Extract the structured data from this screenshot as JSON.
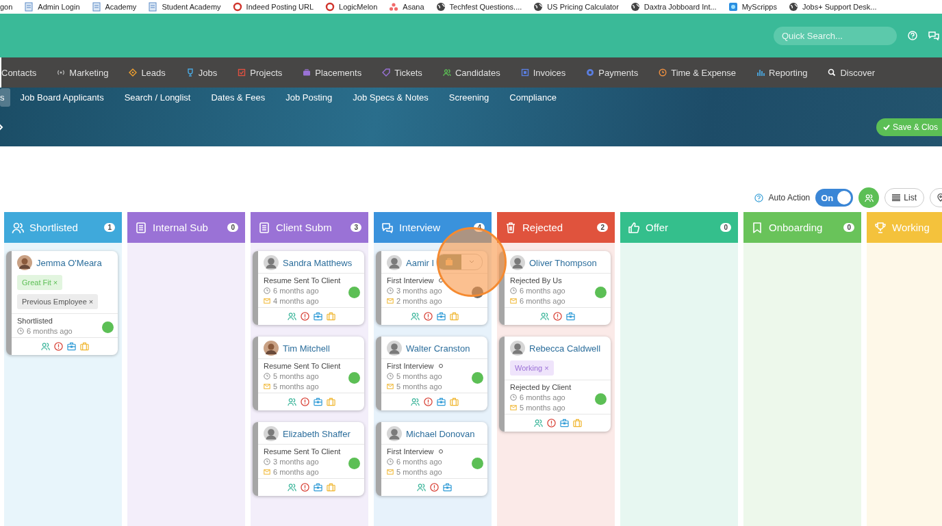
{
  "bookmarks": [
    {
      "label": "gon",
      "kind": "none"
    },
    {
      "label": "Admin Login",
      "kind": "page"
    },
    {
      "label": "Academy",
      "kind": "page"
    },
    {
      "label": "Student Academy",
      "kind": "page"
    },
    {
      "label": "Indeed Posting URL",
      "kind": "ring"
    },
    {
      "label": "LogicMelon",
      "kind": "ring"
    },
    {
      "label": "Asana",
      "kind": "dots"
    },
    {
      "label": "Techfest Questions....",
      "kind": "globe"
    },
    {
      "label": "US Pricing Calculator",
      "kind": "globe"
    },
    {
      "label": "Daxtra Jobboard Int...",
      "kind": "globe"
    },
    {
      "label": "MyScripps",
      "kind": "square"
    },
    {
      "label": "Jobs+ Support Desk...",
      "kind": "globe"
    }
  ],
  "search": {
    "placeholder": "Quick Search..."
  },
  "nav": [
    {
      "label": "Contacts",
      "kind": "none"
    },
    {
      "label": "Marketing",
      "kind": "antenna"
    },
    {
      "label": "Leads",
      "kind": "diamond"
    },
    {
      "label": "Jobs",
      "kind": "trophy"
    },
    {
      "label": "Projects",
      "kind": "checkbox"
    },
    {
      "label": "Placements",
      "kind": "briefcase"
    },
    {
      "label": "Tickets",
      "kind": "tag"
    },
    {
      "label": "Candidates",
      "kind": "people"
    },
    {
      "label": "Invoices",
      "kind": "square"
    },
    {
      "label": "Payments",
      "kind": "coin"
    },
    {
      "label": "Time & Expense",
      "kind": "clock"
    },
    {
      "label": "Reporting",
      "kind": "bars"
    },
    {
      "label": "Discover",
      "kind": "search"
    }
  ],
  "tabs": [
    {
      "label": "s",
      "selected": true
    },
    {
      "label": "Job Board Applicants",
      "selected": false
    },
    {
      "label": "Search / Longlist",
      "selected": false
    },
    {
      "label": "Dates & Fees",
      "selected": false
    },
    {
      "label": "Job Posting",
      "selected": false
    },
    {
      "label": "Job Specs & Notes",
      "selected": false
    },
    {
      "label": "Screening",
      "selected": false
    },
    {
      "label": "Compliance",
      "selected": false
    }
  ],
  "save_button": "Save & Clos",
  "toolbar": {
    "auto_action": "Auto Action",
    "toggle": {
      "label": "On",
      "on": true
    },
    "list_button": "List"
  },
  "columns": [
    {
      "title": "Shortlisted",
      "count": "1",
      "color": "#3fa9db",
      "kind": "people",
      "cards": [
        {
          "name": "Jemma O'Meara",
          "avatar": {
            "kind": "photo"
          },
          "tags": [
            {
              "label": "Great Fit",
              "remove": "×",
              "kind": "green"
            },
            {
              "label": "Previous Employee",
              "remove": "×",
              "kind": "grey"
            }
          ],
          "status": "Shortlisted",
          "created": "6 months ago",
          "color": "#5cbf55",
          "actions": [
            {
              "kind": "people"
            },
            {
              "kind": "alert"
            },
            {
              "kind": "briefcase"
            },
            {
              "kind": "case"
            }
          ]
        }
      ]
    },
    {
      "title": "Internal Sub",
      "count": "0",
      "color": "#9a72d6",
      "kind": "doc"
    },
    {
      "title": "Client Subm",
      "count": "3",
      "color": "#9a72d6",
      "kind": "doc",
      "cards": [
        {
          "name": "Sandra Matthews",
          "avatar": {
            "kind": "placeholder"
          },
          "status": "Resume Sent To Client",
          "created": "6 months ago",
          "emailed": "4 months ago",
          "color": "#5cbf55",
          "actions": [
            {
              "kind": "people"
            },
            {
              "kind": "alert"
            },
            {
              "kind": "briefcase"
            },
            {
              "kind": "case"
            }
          ]
        },
        {
          "name": "Tim Mitchell",
          "avatar": {
            "kind": "photo"
          },
          "status": "Resume Sent To Client",
          "created": "5 months ago",
          "emailed": "5 months ago",
          "color": "#5cbf55",
          "actions": [
            {
              "kind": "people"
            },
            {
              "kind": "alert"
            },
            {
              "kind": "briefcase"
            },
            {
              "kind": "case"
            }
          ]
        },
        {
          "name": "Elizabeth Shaffer",
          "avatar": {
            "kind": "placeholder"
          },
          "status": "Resume Sent To Client",
          "created": "3 months ago",
          "emailed": "6 months ago",
          "color": "#5cbf55",
          "actions": [
            {
              "kind": "people"
            },
            {
              "kind": "alert"
            },
            {
              "kind": "briefcase"
            },
            {
              "kind": "case"
            }
          ]
        }
      ]
    },
    {
      "title": "Interview",
      "count": "4",
      "color": "#3a92dc",
      "kind": "chat",
      "cards": [
        {
          "name": "Aamir I",
          "avatar": {
            "kind": "placeholder"
          },
          "status": "First Interview",
          "status_marker": true,
          "created": "3 months ago",
          "emailed": "2 months ago",
          "color": "#6b6b6b",
          "menu_open": true,
          "actions": [
            {
              "kind": "people"
            },
            {
              "kind": "alert"
            },
            {
              "kind": "briefcase"
            },
            {
              "kind": "case"
            }
          ]
        },
        {
          "name": "Walter Cranston",
          "avatar": {
            "kind": "placeholder"
          },
          "status": "First Interview",
          "status_marker": true,
          "created": "5 months ago",
          "emailed": "5 months ago",
          "color": "#5cbf55",
          "actions": [
            {
              "kind": "people"
            },
            {
              "kind": "alert"
            },
            {
              "kind": "briefcase"
            },
            {
              "kind": "case"
            }
          ]
        },
        {
          "name": "Michael Donovan",
          "avatar": {
            "kind": "placeholder"
          },
          "status": "First Interview",
          "status_marker": true,
          "created": "6 months ago",
          "emailed": "5 months ago",
          "color": "#5cbf55",
          "actions": [
            {
              "kind": "people"
            },
            {
              "kind": "alert"
            },
            {
              "kind": "briefcase"
            }
          ]
        }
      ]
    },
    {
      "title": "Rejected",
      "count": "2",
      "color": "#e0533d",
      "kind": "trash",
      "cards": [
        {
          "name": "Oliver Thompson",
          "avatar": {
            "kind": "placeholder"
          },
          "status": "Rejected By Us",
          "created": "6 months ago",
          "emailed": "6 months ago",
          "color": "#5cbf55",
          "actions": [
            {
              "kind": "people"
            },
            {
              "kind": "alert"
            },
            {
              "kind": "briefcase"
            }
          ]
        },
        {
          "name": "Rebecca Caldwell",
          "avatar": {
            "kind": "placeholder"
          },
          "tags": [
            {
              "label": "Working",
              "remove": "×",
              "kind": "purple"
            }
          ],
          "status": "Rejected by Client",
          "created": "6 months ago",
          "emailed": "5 months ago",
          "color": "#5cbf55",
          "actions": [
            {
              "kind": "people"
            },
            {
              "kind": "alert"
            },
            {
              "kind": "briefcase"
            },
            {
              "kind": "case"
            }
          ]
        }
      ]
    },
    {
      "title": "Offer",
      "count": "0",
      "color": "#34bf8c",
      "kind": "thumb"
    },
    {
      "title": "Onboarding",
      "count": "0",
      "color": "#69c35a",
      "kind": "bookmark"
    },
    {
      "title": "Working",
      "color": "#f4c23c",
      "kind": "trophy"
    }
  ]
}
